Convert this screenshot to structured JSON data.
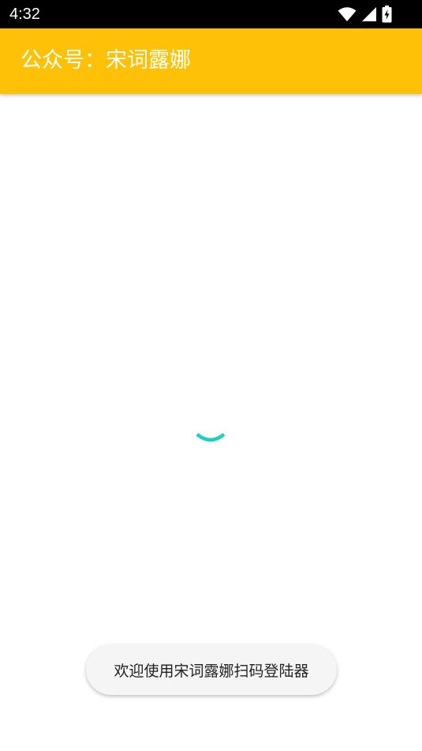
{
  "status_bar": {
    "time": "4:32",
    "icons": [
      "wifi-icon",
      "cellular-signal-icon",
      "battery-charging-icon"
    ]
  },
  "app_bar": {
    "title": "公众号：宋词露娜",
    "color": "#FFC107"
  },
  "content": {
    "loading_indicator": "spinner-icon",
    "spinner_color": "#1DCFC0"
  },
  "toast": {
    "message": "欢迎使用宋词露娜扫码登陆器"
  }
}
